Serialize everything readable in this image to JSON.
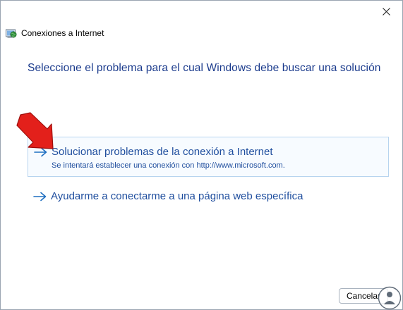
{
  "window": {
    "title": "Conexiones a Internet"
  },
  "heading": "Seleccione el problema para el cual Windows debe buscar una solución",
  "options": [
    {
      "title": "Solucionar problemas de la conexión a Internet",
      "description": "Se intentará establecer una conexión con http://www.microsoft.com."
    },
    {
      "title": "Ayudarme a conectarme a una página web específica"
    }
  ],
  "footer": {
    "cancel_label": "Cancelar"
  },
  "icons": {
    "app": "network-globe-icon",
    "close": "close-icon",
    "option_arrow": "arrow-right-icon",
    "pointer": "red-pointer-arrow",
    "watermark": "logo-watermark"
  },
  "colors": {
    "heading": "#1a3a8c",
    "link": "#1f4e9e",
    "highlight_border": "#b7d4ef",
    "pointer": "#e3201b"
  }
}
